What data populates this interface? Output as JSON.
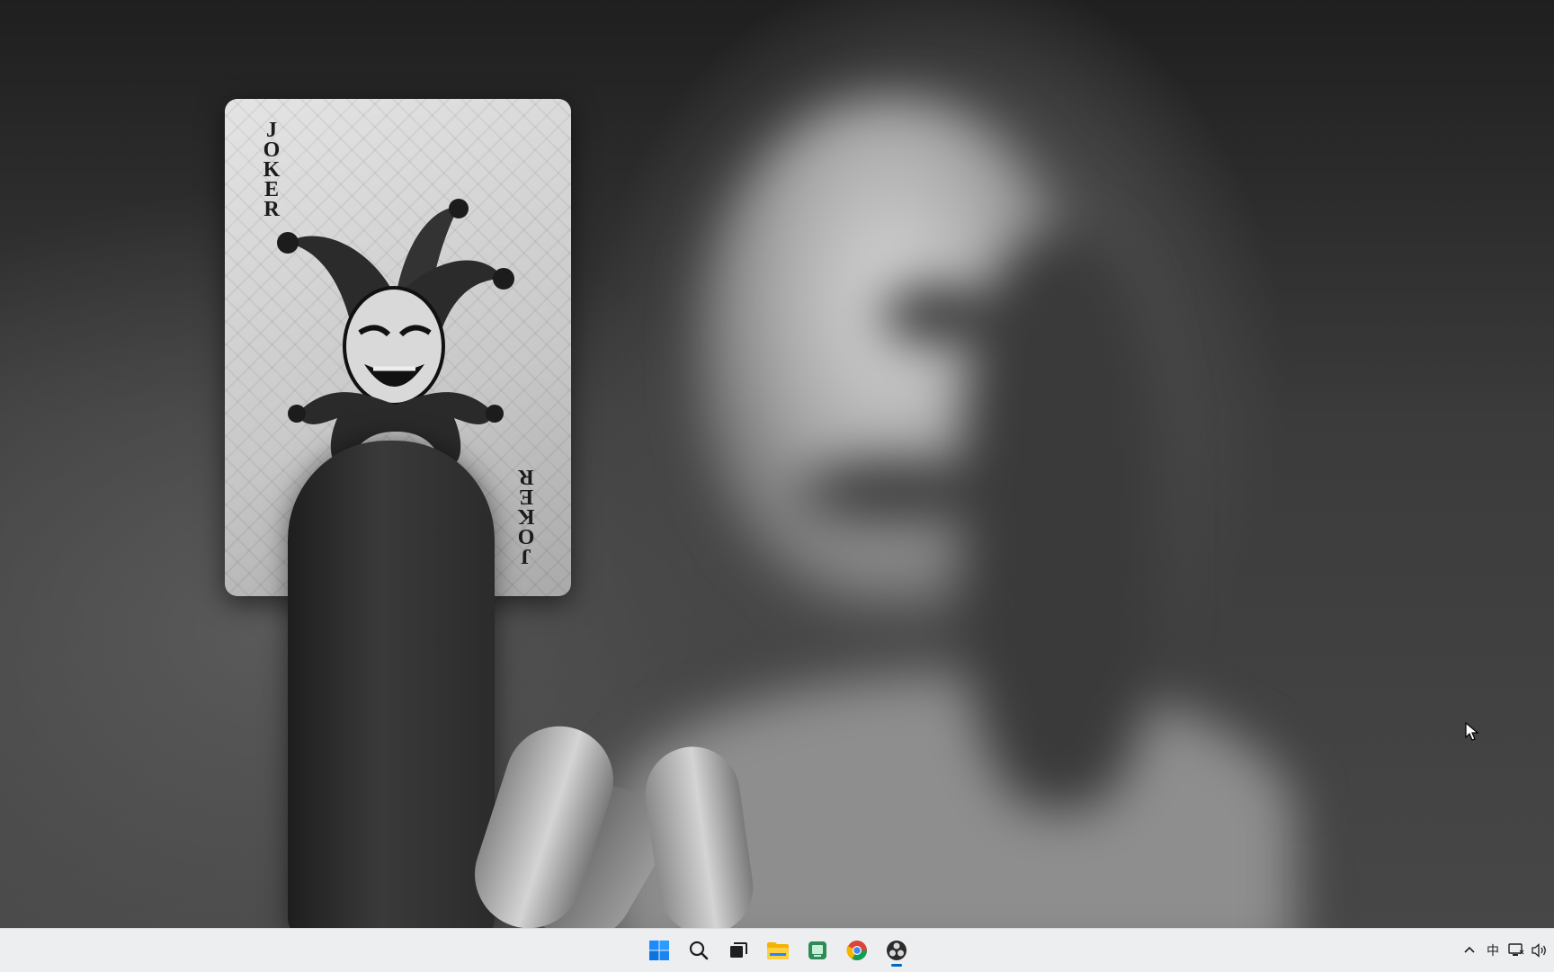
{
  "desktop": {
    "card": {
      "top_text": "JOKER",
      "bottom_text": "JOKER"
    }
  },
  "taskbar": {
    "apps": [
      {
        "name": "start-icon"
      },
      {
        "name": "search-icon"
      },
      {
        "name": "task-view-icon"
      },
      {
        "name": "file-explorer-icon"
      },
      {
        "name": "app-green-icon"
      },
      {
        "name": "chrome-icon"
      },
      {
        "name": "obs-icon",
        "active": true
      }
    ],
    "tray": {
      "ime_label": "中"
    }
  },
  "colors": {
    "taskbar_bg": "#eceef0",
    "accent": "#0067c0"
  }
}
